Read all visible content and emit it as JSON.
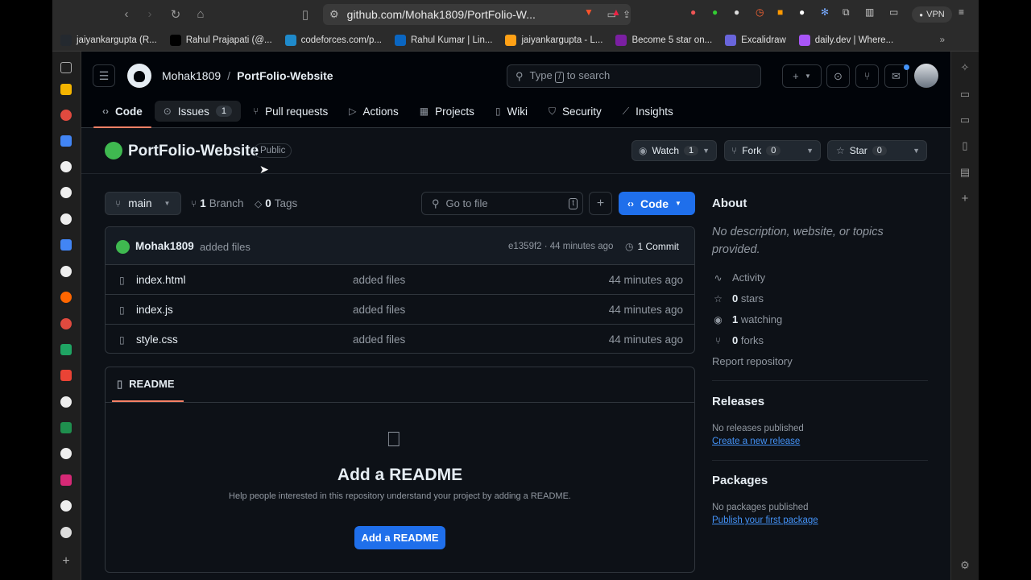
{
  "browser": {
    "url": "github.com/Mohak1809/PortFolio-W...",
    "vpn_label": "VPN",
    "bookmarks": [
      {
        "label": "jaiyankargupta (R...",
        "color": "#24292f"
      },
      {
        "label": "Rahul Prajapati (@...",
        "color": "#000000"
      },
      {
        "label": "codeforces.com/p...",
        "color": "#1f8acb"
      },
      {
        "label": "Rahul Kumar | Lin...",
        "color": "#0a66c2"
      },
      {
        "label": "jaiyankargupta - L...",
        "color": "#ffa116"
      },
      {
        "label": "Become 5 star on...",
        "color": "#7b1fa2"
      },
      {
        "label": "Excalidraw",
        "color": "#6965db"
      },
      {
        "label": "daily.dev | Where...",
        "color": "#a855f7"
      }
    ]
  },
  "header": {
    "owner": "Mohak1809",
    "separator": "/",
    "repo": "PortFolio-Website",
    "search_prefix": "Type",
    "search_key": "/",
    "search_suffix": "to search"
  },
  "tabs": [
    {
      "label": "Code",
      "icon": "code-icon"
    },
    {
      "label": "Issues",
      "icon": "issue-icon",
      "count": "1"
    },
    {
      "label": "Pull requests",
      "icon": "pull-request-icon"
    },
    {
      "label": "Actions",
      "icon": "play-icon"
    },
    {
      "label": "Projects",
      "icon": "table-icon"
    },
    {
      "label": "Wiki",
      "icon": "book-icon"
    },
    {
      "label": "Security",
      "icon": "shield-icon"
    },
    {
      "label": "Insights",
      "icon": "graph-icon"
    }
  ],
  "repo": {
    "name": "PortFolio-Website",
    "visibility": "Public",
    "watch_label": "Watch",
    "watch_count": "1",
    "fork_label": "Fork",
    "fork_count": "0",
    "star_label": "Star",
    "star_count": "0"
  },
  "toolbar": {
    "branch": "main",
    "branch_count": "1",
    "branch_label": "Branch",
    "tag_count": "0",
    "tag_label": "Tags",
    "goto_placeholder": "Go to file",
    "goto_key": "t",
    "code_label": "Code"
  },
  "commit": {
    "author": "Mohak1809",
    "message": "added files",
    "hash_time": "e1359f2 · 44 minutes ago",
    "commit_count": "1 Commit"
  },
  "files": [
    {
      "name": "index.html",
      "message": "added files",
      "time": "44 minutes ago"
    },
    {
      "name": "index.js",
      "message": "added files",
      "time": "44 minutes ago"
    },
    {
      "name": "style.css",
      "message": "added files",
      "time": "44 minutes ago"
    }
  ],
  "readme": {
    "tab_label": "README",
    "title": "Add a README",
    "description": "Help people interested in this repository understand your project by adding a README.",
    "button": "Add a README"
  },
  "about": {
    "heading": "About",
    "description": "No description, website, or topics provided.",
    "activity": "Activity",
    "stars_count": "0",
    "stars_label": "stars",
    "watching_count": "1",
    "watching_label": "watching",
    "forks_count": "0",
    "forks_label": "forks",
    "report": "Report repository"
  },
  "releases": {
    "heading": "Releases",
    "status": "No releases published",
    "link": "Create a new release"
  },
  "packages": {
    "heading": "Packages",
    "status": "No packages published",
    "link": "Publish your first package"
  },
  "colors": {
    "bg": "#0d1117",
    "header_bg": "#010409",
    "accent_blue": "#1f6feb",
    "link_blue": "#4493f8",
    "tab_underline": "#f78166",
    "muted": "#9198a1"
  }
}
